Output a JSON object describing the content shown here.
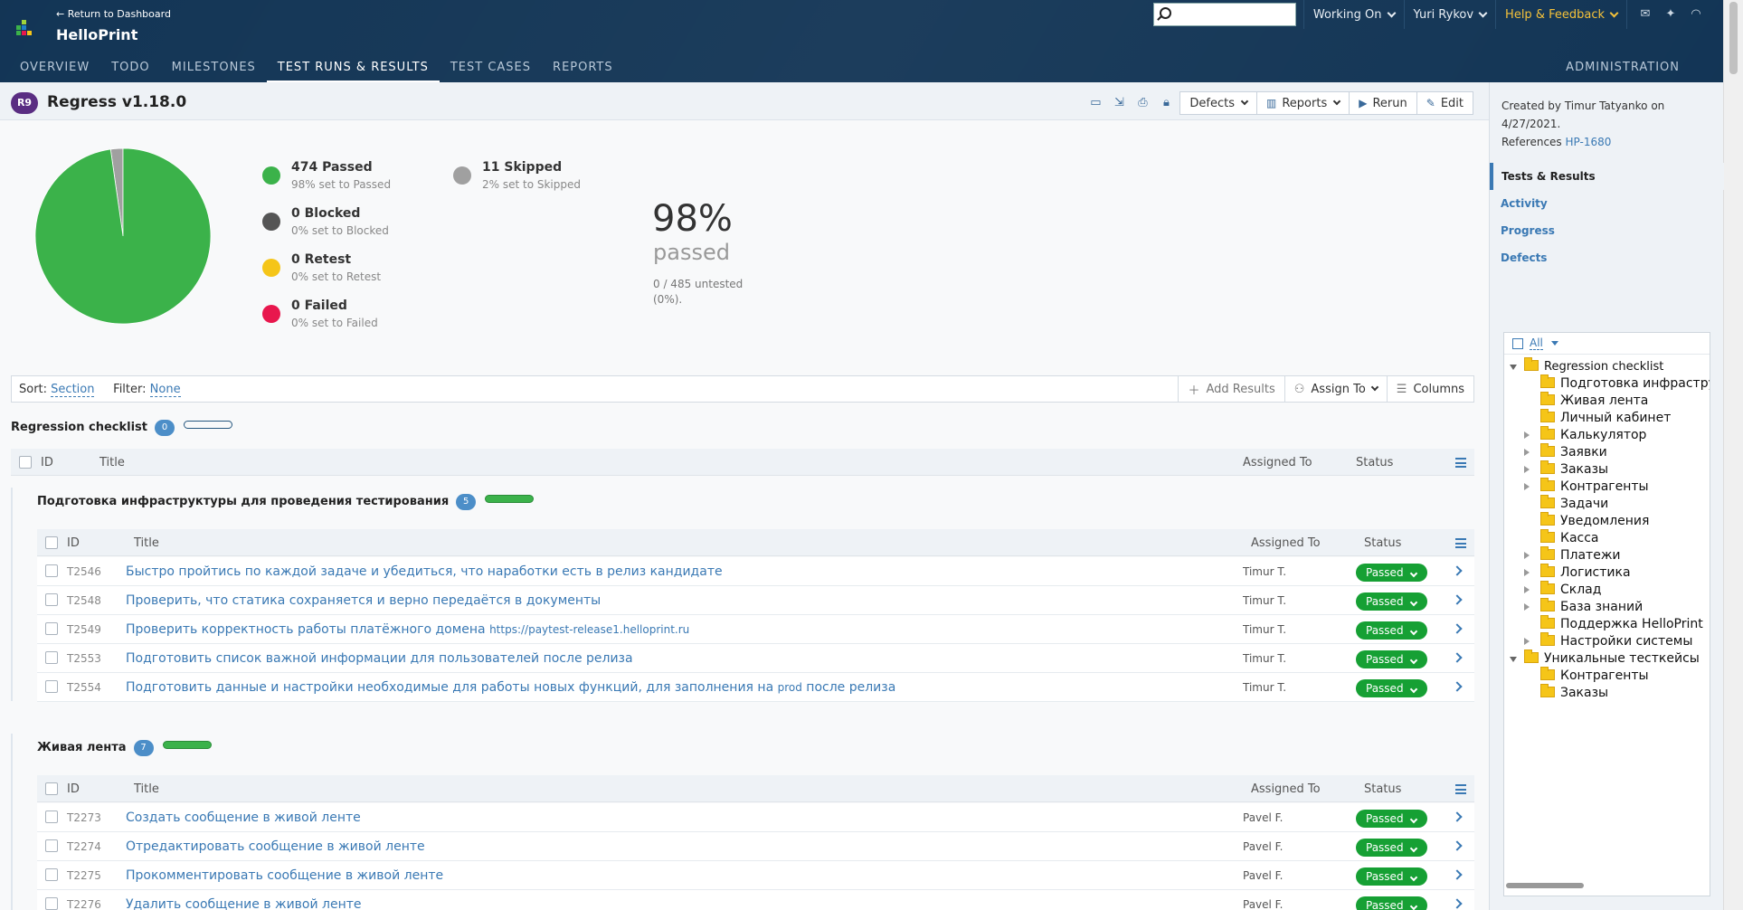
{
  "header": {
    "return_link": "← Return to Dashboard",
    "project_name": "HelloPrint",
    "search_placeholder": "",
    "working_on": "Working On",
    "user": "Yuri Rykov",
    "help": "Help & Feedback",
    "nav": [
      "OVERVIEW",
      "TODO",
      "MILESTONES",
      "TEST RUNS & RESULTS",
      "TEST CASES",
      "REPORTS"
    ],
    "admin": "ADMINISTRATION",
    "colors": {
      "bg": "#0e3152",
      "help": "#f4c13a"
    }
  },
  "run": {
    "badge": "R9",
    "title": "Regress v1.18.0",
    "actions": {
      "defects": "Defects",
      "reports": "Reports",
      "rerun": "Rerun",
      "edit": "Edit"
    }
  },
  "stats": {
    "legend": [
      {
        "count": "474 Passed",
        "sub": "98% set to Passed",
        "color": "#3bb24a"
      },
      {
        "count": "0 Blocked",
        "sub": "0% set to Blocked",
        "color": "#555555"
      },
      {
        "count": "0 Retest",
        "sub": "0% set to Retest",
        "color": "#f5c518"
      },
      {
        "count": "0 Failed",
        "sub": "0% set to Failed",
        "color": "#e8174d"
      },
      {
        "count": "11 Skipped",
        "sub": "2% set to Skipped",
        "color": "#a0a0a0"
      }
    ],
    "percent": "98%",
    "percent_label": "passed",
    "untested": "0 / 485 untested (0%)."
  },
  "chart_data": {
    "type": "pie",
    "categories": [
      "Passed",
      "Blocked",
      "Retest",
      "Failed",
      "Skipped"
    ],
    "values": [
      474,
      0,
      0,
      0,
      11
    ],
    "colors": [
      "#3bb24a",
      "#555555",
      "#f5c518",
      "#e8174d",
      "#a0a0a0"
    ]
  },
  "toolbar": {
    "sort_label": "Sort:",
    "sort_value": "Section",
    "filter_label": "Filter:",
    "filter_value": "None",
    "add_results": "Add Results",
    "assign_to": "Assign To",
    "columns": "Columns"
  },
  "columns": {
    "id": "ID",
    "title": "Title",
    "assigned": "Assigned To",
    "status": "Status"
  },
  "root_section": {
    "title": "Regression checklist",
    "count": "0"
  },
  "sections": [
    {
      "title": "Подготовка инфраструктуры для проведения тестирования",
      "count": "5",
      "rows": [
        {
          "id": "T2546",
          "title": "Быстро пройтись по каждой задаче и убедиться, что наработки есть в релиз кандидате",
          "url": "",
          "tail": "",
          "assigned": "Timur T.",
          "status": "Passed"
        },
        {
          "id": "T2548",
          "title": "Проверить, что статика сохраняется и верно передаётся в документы",
          "url": "",
          "tail": "",
          "assigned": "Timur T.",
          "status": "Passed"
        },
        {
          "id": "T2549",
          "title": "Проверить корректность работы платёжного домена ",
          "url": "https://paytest-release1.helloprint.ru",
          "tail": "",
          "assigned": "Timur T.",
          "status": "Passed"
        },
        {
          "id": "T2553",
          "title": "Подготовить список важной информации для пользователей после релиза",
          "url": "",
          "tail": "",
          "assigned": "Timur T.",
          "status": "Passed"
        },
        {
          "id": "T2554",
          "title": "Подготовить данные и настройки необходимые для работы новых функций, для заполнения на ",
          "url": "prod",
          "tail": " после релиза",
          "assigned": "Timur T.",
          "status": "Passed"
        }
      ]
    },
    {
      "title": "Живая лента",
      "count": "7",
      "rows": [
        {
          "id": "T2273",
          "title": "Создать сообщение в живой ленте",
          "url": "",
          "tail": "",
          "assigned": "Pavel F.",
          "status": "Passed"
        },
        {
          "id": "T2274",
          "title": "Отредактировать сообщение в живой ленте",
          "url": "",
          "tail": "",
          "assigned": "Pavel F.",
          "status": "Passed"
        },
        {
          "id": "T2275",
          "title": "Прокомментировать сообщение в живой ленте",
          "url": "",
          "tail": "",
          "assigned": "Pavel F.",
          "status": "Passed"
        },
        {
          "id": "T2276",
          "title": "Удалить сообщение в живой ленте",
          "url": "",
          "tail": "",
          "assigned": "Pavel F.",
          "status": "Passed"
        }
      ]
    }
  ],
  "sidebar": {
    "created_by": "Created by Timur Tatyanko on 4/27/2021.",
    "references_label": "References",
    "reference": "HP-1680",
    "nav": [
      "Tests & Results",
      "Activity",
      "Progress",
      "Defects"
    ],
    "tree_filter": "All",
    "tree": [
      {
        "label": "Regression checklist",
        "level": 0,
        "toggle": "open",
        "small": true
      },
      {
        "label": "Подготовка инфраструктуры",
        "level": 1,
        "toggle": "",
        "small": false
      },
      {
        "label": "Живая лента",
        "level": 1,
        "toggle": "",
        "small": false
      },
      {
        "label": "Личный кабинет",
        "level": 1,
        "toggle": "",
        "small": false
      },
      {
        "label": "Калькулятор",
        "level": 1,
        "toggle": "closed",
        "small": false
      },
      {
        "label": "Заявки",
        "level": 1,
        "toggle": "closed",
        "small": false
      },
      {
        "label": "Заказы",
        "level": 1,
        "toggle": "closed",
        "small": false
      },
      {
        "label": "Контрагенты",
        "level": 1,
        "toggle": "closed",
        "small": false
      },
      {
        "label": "Задачи",
        "level": 1,
        "toggle": "",
        "small": false
      },
      {
        "label": "Уведомления",
        "level": 1,
        "toggle": "",
        "small": false
      },
      {
        "label": "Касса",
        "level": 1,
        "toggle": "",
        "small": false
      },
      {
        "label": "Платежи",
        "level": 1,
        "toggle": "closed",
        "small": false
      },
      {
        "label": "Логистика",
        "level": 1,
        "toggle": "closed",
        "small": false
      },
      {
        "label": "Склад",
        "level": 1,
        "toggle": "closed",
        "small": false
      },
      {
        "label": "База знаний",
        "level": 1,
        "toggle": "closed",
        "small": false
      },
      {
        "label": "Поддержка HelloPrint",
        "level": 1,
        "toggle": "",
        "small": false
      },
      {
        "label": "Настройки системы",
        "level": 1,
        "toggle": "closed",
        "small": false
      },
      {
        "label": "Уникальные тесткейсы",
        "level": 0,
        "toggle": "open",
        "small": false
      },
      {
        "label": "Контрагенты",
        "level": 1,
        "toggle": "",
        "small": false
      },
      {
        "label": "Заказы",
        "level": 1,
        "toggle": "",
        "small": false
      }
    ]
  }
}
